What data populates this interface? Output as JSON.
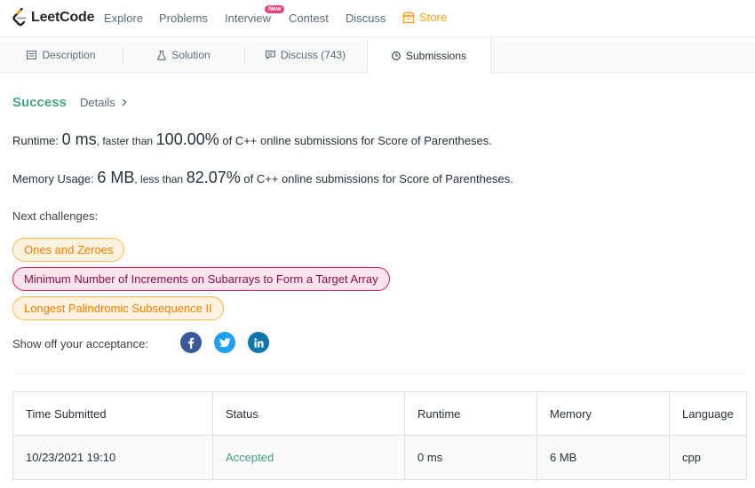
{
  "nav": {
    "logo_text": "LeetCode",
    "items": [
      "Explore",
      "Problems",
      "Interview",
      "Contest",
      "Discuss"
    ],
    "interview_badge": "New",
    "store": "Store"
  },
  "tabs": [
    {
      "label": "Description",
      "icon": "description-icon"
    },
    {
      "label": "Solution",
      "icon": "flask-icon"
    },
    {
      "label": "Discuss (743)",
      "icon": "comment-icon"
    },
    {
      "label": "Submissions",
      "icon": "clock-icon",
      "active": true
    }
  ],
  "result": {
    "status": "Success",
    "details": "Details"
  },
  "runtime": {
    "label": "Runtime:",
    "value": "0 ms",
    "faster_text": ", faster than",
    "percent": "100.00%",
    "suffix": "of C++ online submissions for Score of Parentheses."
  },
  "memory": {
    "label": "Memory Usage:",
    "value": "6 MB",
    "less_text": ", less than",
    "percent": "82.07%",
    "suffix": "of C++ online submissions for Score of Parentheses."
  },
  "next": {
    "label": "Next challenges:",
    "challenges": [
      {
        "title": "Ones and Zeroes",
        "difficulty": "medium"
      },
      {
        "title": "Minimum Number of Increments on Subarrays to Form a Target Array",
        "difficulty": "hard"
      },
      {
        "title": "Longest Palindromic Subsequence II",
        "difficulty": "medium"
      }
    ]
  },
  "share": {
    "label": "Show off your acceptance:",
    "networks": [
      {
        "name": "facebook",
        "glyph": "f",
        "color": "#3b5998"
      },
      {
        "name": "twitter",
        "glyph": "t",
        "color": "#1da1f2"
      },
      {
        "name": "linkedin",
        "glyph": "in",
        "color": "#0e76a8"
      }
    ]
  },
  "table": {
    "headers": [
      "Time Submitted",
      "Status",
      "Runtime",
      "Memory",
      "Language"
    ],
    "rows": [
      [
        "10/23/2021 19:10",
        "Accepted",
        "0 ms",
        "6 MB",
        "cpp"
      ]
    ]
  },
  "colors": {
    "accent": "#ffa116",
    "success": "#47a386",
    "badge": "#ec407a"
  }
}
